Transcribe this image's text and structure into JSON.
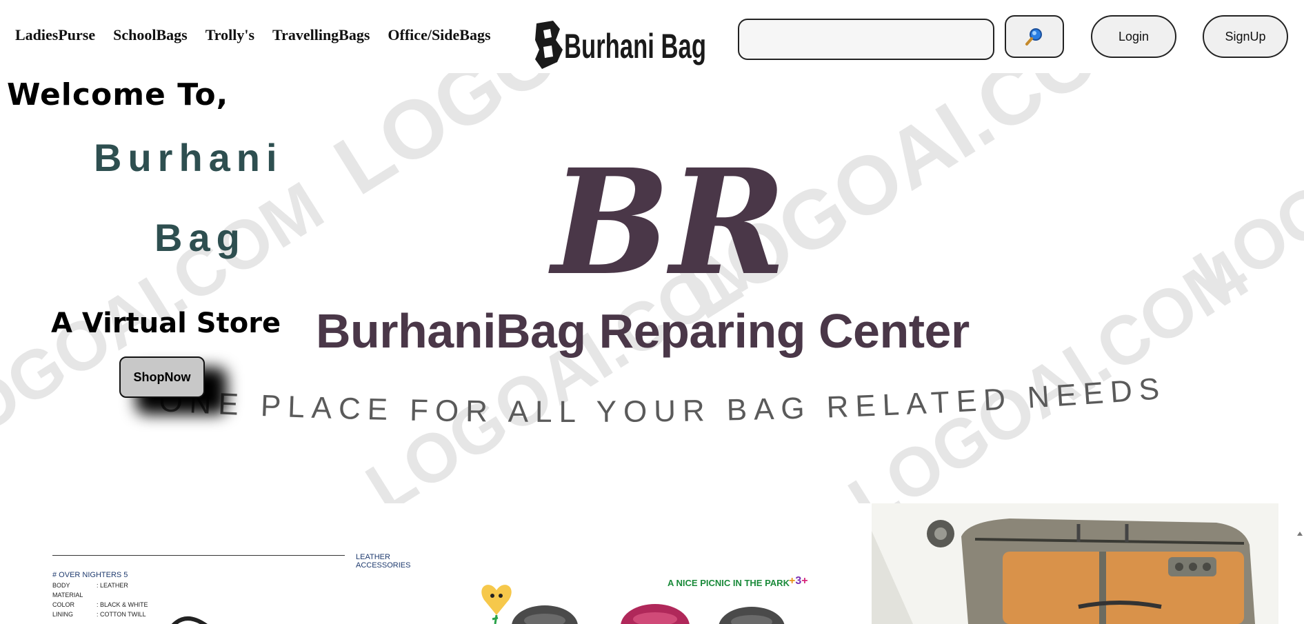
{
  "nav": {
    "links": [
      "LadiesPurse",
      "SchoolBags",
      "Trolly's",
      "TravellingBags",
      "Office/SideBags"
    ],
    "brand": "Burhani Bag",
    "search_placeholder": "",
    "login_label": "Login",
    "signup_label": "SignUp"
  },
  "hero": {
    "welcome": "Welcome To,",
    "brand_line1": "Burhani",
    "brand_line2": "Bag",
    "tagline": "A Virtual Store",
    "shop_now": "ShopNow",
    "center_logo_letters": "BR",
    "center_title": "BurhaniBag Reparing Center",
    "slogan": "ONE PLACE FOR ALL YOUR BAG RELATED NEEDS",
    "watermark": "LOGOAI.COM"
  },
  "products": {
    "card1": {
      "header": "LEATHER ACCESSORIES",
      "title": "# OVER NIGHTERS 5",
      "rows": [
        {
          "k": "BODY MATERIAL",
          "v": ": LEATHER"
        },
        {
          "k": "COLOR",
          "v": ": BLACK & WHITE"
        },
        {
          "k": "LINING",
          "v": ": COTTON TWILL"
        }
      ]
    },
    "card2": {
      "caption": "A NICE PICNIC IN THE PARK",
      "badge": "3"
    }
  },
  "colors": {
    "brand_teal": "#2e4f50",
    "center_purple": "#4a3748",
    "card_blue": "#1e3a6e",
    "caption_green": "#1a8a3a",
    "accent_orange": "#e8941a"
  }
}
